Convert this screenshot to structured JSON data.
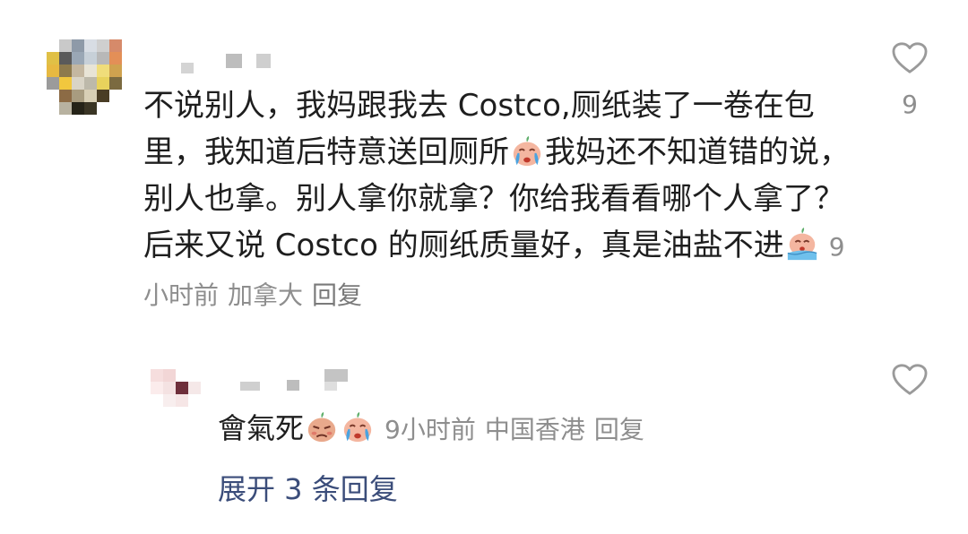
{
  "comment": {
    "text": "不说别人，我妈跟我去 Costco,厕纸装了一卷在包里，我知道后特意送回厕所",
    "text_part2": "我妈还不知道错的说，别人也拿。别人拿你就拿？你给我看看哪个人拿了？后来又说 Costco 的厕纸质量好，真是油盐不进",
    "time": "9小时前",
    "location": "加拿大",
    "reply_label": "回复",
    "likes": "9",
    "emoji_inline": "crying-face-emoji",
    "emoji_end": "crying-sinking-emoji"
  },
  "reply": {
    "text": "會氣死",
    "time": "9小时前",
    "location": "中国香港",
    "reply_label": "回复",
    "emoji_1": "annoyed-face-emoji",
    "emoji_2": "crying-face-emoji"
  },
  "expand": {
    "label": "展开 3 条回复"
  },
  "colors": {
    "text": "#1e1e1e",
    "meta": "#8e8e8e",
    "link": "#3b4d7a",
    "icon": "#9a9a9a"
  },
  "icons": {
    "like": "heart-outline-icon"
  }
}
